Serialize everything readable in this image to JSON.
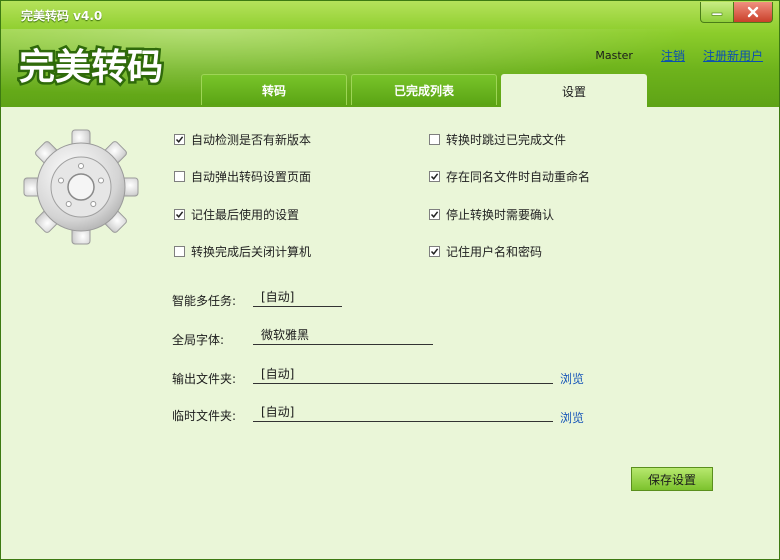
{
  "app": {
    "title": "完美转码 v4.0",
    "logo_text": "完美转码"
  },
  "window_controls": {
    "minimize_icon": "minimize-icon",
    "close_icon": "close-icon"
  },
  "user": {
    "name": "Master",
    "logout_label": "注销",
    "register_label": "注册新用户"
  },
  "tabs": [
    {
      "label": "转码",
      "active": false
    },
    {
      "label": "已完成列表",
      "active": false
    },
    {
      "label": "设置",
      "active": true
    }
  ],
  "settings": {
    "left_options": [
      {
        "label": "自动检测是否有新版本",
        "checked": true
      },
      {
        "label": "自动弹出转码设置页面",
        "checked": false
      },
      {
        "label": "记住最后使用的设置",
        "checked": true
      },
      {
        "label": "转换完成后关闭计算机",
        "checked": false
      }
    ],
    "right_options": [
      {
        "label": "转换时跳过已完成文件",
        "checked": false
      },
      {
        "label": "存在同名文件时自动重命名",
        "checked": true
      },
      {
        "label": "停止转换时需要确认",
        "checked": true
      },
      {
        "label": "记住用户名和密码",
        "checked": true
      }
    ],
    "fields": {
      "multitask": {
        "label": "智能多任务:",
        "value": "[自动]"
      },
      "font": {
        "label": "全局字体:",
        "value": "微软雅黑"
      },
      "output_folder": {
        "label": "输出文件夹:",
        "value": "[自动]",
        "browse": "浏览"
      },
      "temp_folder": {
        "label": "临时文件夹:",
        "value": "[自动]",
        "browse": "浏览"
      }
    },
    "save_label": "保存设置"
  },
  "colors": {
    "header_green": "#6eb31c",
    "content_bg": "#eaf6d8",
    "link_blue": "#0a4fb2"
  }
}
